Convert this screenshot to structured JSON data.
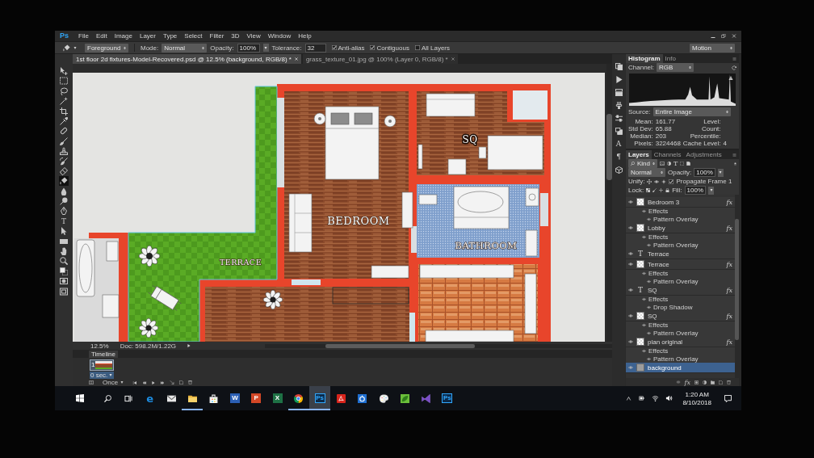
{
  "menu_bar": {
    "logo": "Ps",
    "items": [
      "File",
      "Edit",
      "Image",
      "Layer",
      "Type",
      "Select",
      "Filter",
      "3D",
      "View",
      "Window",
      "Help"
    ]
  },
  "options_bar": {
    "fill_source": "Foreground",
    "mode_label": "Mode:",
    "mode": "Normal",
    "opacity_label": "Opacity:",
    "opacity": "100%",
    "tolerance_label": "Tolerance:",
    "tolerance": "32",
    "checkboxes": [
      {
        "label": "Anti-alias",
        "checked": true
      },
      {
        "label": "Contiguous",
        "checked": true
      },
      {
        "label": "All Layers",
        "checked": false
      }
    ],
    "workspace": "Motion"
  },
  "toolbar": {
    "tools": [
      {
        "kind": "move",
        "selected": false
      },
      {
        "kind": "marquee",
        "selected": false
      },
      {
        "kind": "lasso",
        "selected": false
      },
      {
        "kind": "wand",
        "selected": false
      },
      {
        "kind": "crop",
        "selected": false
      },
      {
        "kind": "eyedropper",
        "selected": false
      },
      {
        "kind": "healing",
        "selected": false
      },
      {
        "kind": "brush",
        "selected": false
      },
      {
        "kind": "stamp",
        "selected": false
      },
      {
        "kind": "history_brush",
        "selected": false
      },
      {
        "kind": "eraser",
        "selected": false
      },
      {
        "kind": "bucket",
        "selected": true
      },
      {
        "kind": "blur",
        "selected": false
      },
      {
        "kind": "dodge",
        "selected": false
      },
      {
        "kind": "pen",
        "selected": false
      },
      {
        "kind": "type",
        "glyph": "T",
        "selected": false
      },
      {
        "kind": "path_select",
        "selected": false
      },
      {
        "kind": "rectangle",
        "selected": false
      },
      {
        "kind": "hand",
        "selected": false
      },
      {
        "kind": "zoom",
        "selected": false
      },
      {
        "kind": "colors",
        "selected": false
      },
      {
        "kind": "quick_mask",
        "selected": false
      },
      {
        "kind": "screen_mode",
        "selected": false
      }
    ]
  },
  "document_tabs": [
    {
      "title": "1st floor 2d fixtures-Model-Recovered.psd @ 12.5% (background, RGB/8) *",
      "selected": true
    },
    {
      "title": "grass_texture_01.jpg @ 100% (Layer 0, RGB/8) *",
      "selected": false
    }
  ],
  "canvas": {
    "bedroom_label": "BEDROOM",
    "sq_label": "SQ",
    "bathroom_label": "BATHROOM",
    "terrace_label": "TERRACE"
  },
  "status_bar": {
    "zoom": "12.5%",
    "document_size": "Doc: 598.2M/1.22G"
  },
  "timeline": {
    "title": "Timeline",
    "frames": [
      {
        "number": "1",
        "delay": "0 sec.",
        "selected": true
      }
    ],
    "loop": "Once"
  },
  "dock": [
    {
      "kind": "history"
    },
    {
      "kind": "actions"
    },
    {
      "kind": "layer_comps"
    },
    {
      "kind": "brush_presets"
    },
    {
      "kind": "adjustments"
    },
    {
      "kind": "clone_source"
    },
    {
      "kind": "character",
      "glyph": "A"
    },
    {
      "kind": "paragraph",
      "glyph": "¶"
    },
    {
      "kind": "cube"
    }
  ],
  "histogram": {
    "tabs": [
      {
        "label": "Histogram",
        "selected": true
      },
      {
        "label": "Info",
        "selected": false
      }
    ],
    "channel_label": "Channel:",
    "channel": "RGB",
    "source_label": "Source:",
    "source": "Entire Image",
    "stats": [
      {
        "label": "Mean:",
        "value": "161.77"
      },
      {
        "label": "Std Dev:",
        "value": "65.88"
      },
      {
        "label": "Median:",
        "value": "203"
      },
      {
        "label": "Pixels:",
        "value": "3224468"
      }
    ],
    "stats_right": [
      {
        "label": "Level:"
      },
      {
        "label": "Count:"
      },
      {
        "label": "Percentile:"
      },
      {
        "label": "Cache Level:",
        "value": "4"
      }
    ]
  },
  "layers": {
    "tabs": [
      {
        "label": "Layers",
        "selected": true
      },
      {
        "label": "Channels",
        "selected": false
      },
      {
        "label": "Adjustments",
        "selected": false
      }
    ],
    "filter": "Kind",
    "type_filter_glyph": "T",
    "blend_mode": "Normal",
    "opacity_label": "Opacity:",
    "opacity": "100%",
    "unify_label": "Unify:",
    "propagate": {
      "label": "Propagate Frame 1",
      "checked": true
    },
    "lock_label": "Lock:",
    "fill_label": "Fill:",
    "fill": "100%",
    "items": [
      {
        "name": "Bedroom 3",
        "kind": "pixel",
        "visible": true,
        "selected": false,
        "badge": "fx",
        "effects_label": "Effects",
        "effects": [
          "Pattern Overlay"
        ]
      },
      {
        "name": "Lobby",
        "kind": "pixel",
        "visible": true,
        "selected": false,
        "badge": "fx",
        "effects_label": "Effects",
        "effects": [
          "Pattern Overlay"
        ]
      },
      {
        "name": "Terrace",
        "kind": "text",
        "glyph": "T",
        "visible": true,
        "selected": false
      },
      {
        "name": "Terrace",
        "kind": "pixel",
        "visible": true,
        "selected": false,
        "badge": "fx",
        "effects_label": "Effects",
        "effects": [
          "Pattern Overlay"
        ]
      },
      {
        "name": "SQ",
        "kind": "text",
        "glyph": "T",
        "visible": true,
        "selected": false,
        "badge": "fx",
        "effects_label": "Effects",
        "effects": [
          "Drop Shadow"
        ]
      },
      {
        "name": "SQ",
        "kind": "pixel",
        "visible": true,
        "selected": false,
        "badge": "fx",
        "effects_label": "Effects",
        "effects": [
          "Pattern Overlay"
        ]
      },
      {
        "name": "plan original",
        "kind": "pixel",
        "visible": true,
        "selected": false,
        "badge": "fx",
        "effects_label": "Effects",
        "effects": [
          "Pattern Overlay"
        ]
      },
      {
        "name": "background",
        "kind": "image",
        "visible": true,
        "selected": true
      }
    ],
    "footer_glyph": "fx"
  },
  "taskbar": {
    "apps": [
      {
        "kind": "glyph",
        "glyph": "e",
        "color": "#1d8ce0",
        "open": false,
        "selected": false
      },
      {
        "kind": "envelope",
        "open": false,
        "selected": false
      },
      {
        "kind": "folder",
        "open": true,
        "selected": false
      },
      {
        "kind": "bag",
        "open": false,
        "selected": false
      },
      {
        "kind": "tile",
        "glyph": "W",
        "color": "#2b5fb4",
        "open": false,
        "selected": false
      },
      {
        "kind": "tile",
        "glyph": "P",
        "color": "#d24726",
        "open": false,
        "selected": false
      },
      {
        "kind": "tile",
        "glyph": "X",
        "color": "#1e7145",
        "open": false,
        "selected": false
      },
      {
        "kind": "ring",
        "open": true,
        "selected": false
      },
      {
        "kind": "tile",
        "glyph": "Ps",
        "color": "#0b2a4a",
        "open": true,
        "selected": true
      },
      {
        "kind": "pdf",
        "open": false,
        "selected": false
      },
      {
        "kind": "disc",
        "open": false,
        "selected": false
      },
      {
        "kind": "palette",
        "open": false,
        "selected": false
      },
      {
        "kind": "leaf",
        "open": false,
        "selected": false
      },
      {
        "kind": "bowtie",
        "open": false,
        "selected": false
      },
      {
        "kind": "tile",
        "glyph": "Ps",
        "color": "#0b2a4a",
        "open": false,
        "selected": false
      }
    ],
    "time": "1:20 AM",
    "date": "8/10/2018"
  }
}
